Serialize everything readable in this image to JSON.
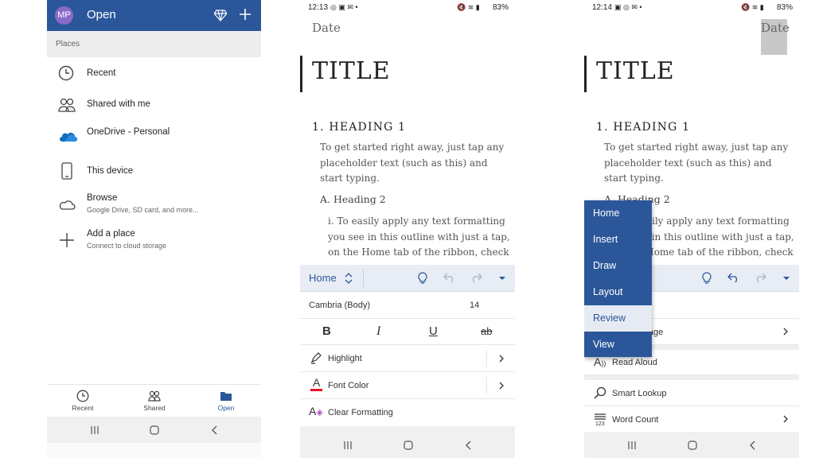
{
  "open_screen": {
    "avatar_initials": "MP",
    "title": "Open",
    "section_header": "Places",
    "places": [
      {
        "label": "Recent",
        "icon": "clock-icon"
      },
      {
        "label": "Shared with me",
        "icon": "people-icon"
      },
      {
        "label": "OneDrive - Personal",
        "icon": "onedrive-cloud-icon"
      },
      {
        "label": "This device",
        "icon": "phone-icon"
      },
      {
        "label": "Browse",
        "sublabel": "Google Drive, SD card, and more...",
        "icon": "cloud-outline-icon"
      },
      {
        "label": "Add a place",
        "sublabel": "Connect to cloud storage",
        "icon": "plus-icon"
      }
    ],
    "bottom_nav": [
      {
        "label": "Recent",
        "icon": "clock-icon"
      },
      {
        "label": "Shared",
        "icon": "people-icon"
      },
      {
        "label": "Open",
        "icon": "folder-icon",
        "active": true
      }
    ],
    "colors": {
      "brand": "#2b579a",
      "avatar": "#8a6ac8"
    }
  },
  "doc_screen_1": {
    "status_time": "12:13",
    "status_battery": "83%",
    "date": "Date",
    "title": "TITLE",
    "heading1": "1. HEADING 1",
    "paragraph": "To get started right away, just tap any placeholder text (such as this) and start typing.",
    "heading2": "A. Heading 2",
    "list_item": "i.  To easily apply any text formatting you see in this outline with just a tap, on the Home tab of the ribbon, check",
    "ribbon_tab": "Home",
    "font_name": "Cambria (Body)",
    "font_size": "14",
    "rows": {
      "highlight": "Highlight",
      "font_color": "Font Color",
      "clear_formatting": "Clear Formatting"
    },
    "font_color_swatch": "#e81123"
  },
  "doc_screen_2": {
    "status_time": "12:14",
    "status_battery": "83%",
    "date": "Date",
    "title": "TITLE",
    "heading1": "1. HEADING 1",
    "paragraph": "To get started right away, just tap any placeholder text (such as this) and start typing.",
    "heading2": "A. Heading 2",
    "list_item": "i.  To easily apply any text formatting you see in this outline with just a tap, on the Home tab of the ribbon, check",
    "menu_items": [
      "Home",
      "Insert",
      "Draw",
      "Layout",
      "Review",
      "View"
    ],
    "menu_selected": "Review",
    "rows": {
      "language": "nd Language",
      "read_aloud": "Read Aloud",
      "smart_lookup": "Smart Lookup",
      "word_count": "Word Count"
    }
  }
}
